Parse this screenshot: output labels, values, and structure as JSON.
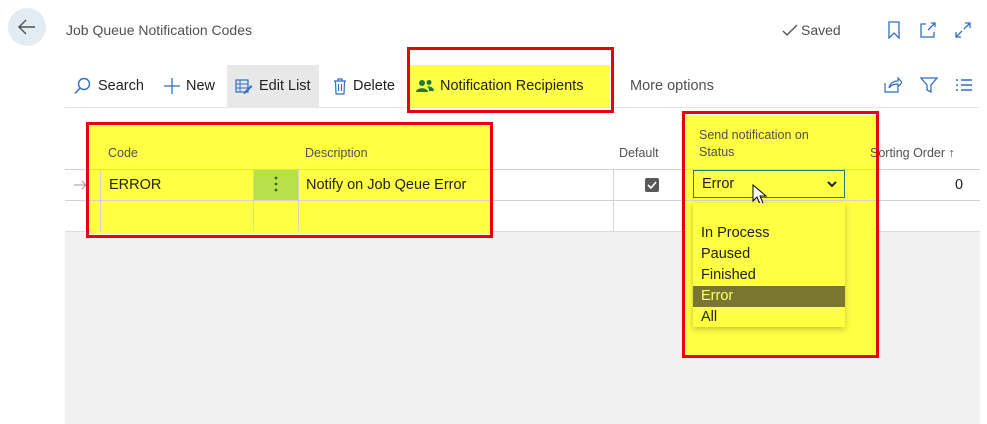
{
  "page": {
    "title": "Job Queue Notification Codes",
    "saved_label": "Saved"
  },
  "commands": {
    "search": "Search",
    "new": "New",
    "edit_list": "Edit List",
    "delete": "Delete",
    "notification_recipients": "Notification Recipients",
    "more_options": "More options"
  },
  "columns": {
    "code": "Code",
    "description": "Description",
    "default": "Default",
    "send_notification_line1": "Send notification on",
    "send_notification_line2": "Status",
    "sorting_order": "Sorting Order",
    "sort_arrow": "↑"
  },
  "rows": [
    {
      "code": "ERROR",
      "description": "Notify on Job Qeue Error",
      "default": true,
      "status": "Error",
      "sorting_order": "0"
    }
  ],
  "status_dropdown": {
    "selected": "Error",
    "options": [
      "",
      "In Process",
      "Paused",
      "Finished",
      "Error",
      "All"
    ]
  },
  "colors": {
    "highlight": "#ffff44",
    "annotation_border": "#e8000f",
    "accent": "#1f7d75",
    "selected_option": "#7a7631"
  }
}
